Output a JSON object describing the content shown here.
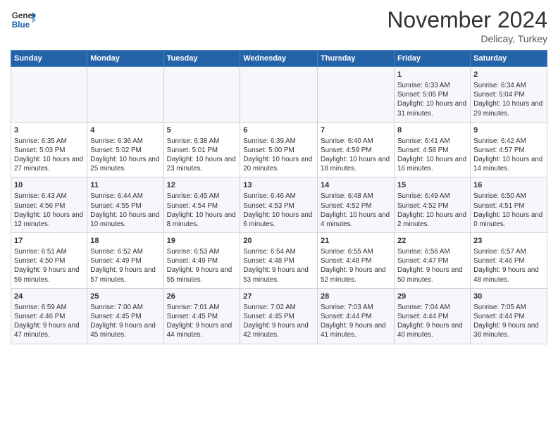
{
  "header": {
    "logo_line1": "General",
    "logo_line2": "Blue",
    "month_title": "November 2024",
    "subtitle": "Delicay, Turkey"
  },
  "weekdays": [
    "Sunday",
    "Monday",
    "Tuesday",
    "Wednesday",
    "Thursday",
    "Friday",
    "Saturday"
  ],
  "weeks": [
    [
      {
        "day": "",
        "info": ""
      },
      {
        "day": "",
        "info": ""
      },
      {
        "day": "",
        "info": ""
      },
      {
        "day": "",
        "info": ""
      },
      {
        "day": "",
        "info": ""
      },
      {
        "day": "1",
        "info": "Sunrise: 6:33 AM\nSunset: 5:05 PM\nDaylight: 10 hours and 31 minutes."
      },
      {
        "day": "2",
        "info": "Sunrise: 6:34 AM\nSunset: 5:04 PM\nDaylight: 10 hours and 29 minutes."
      }
    ],
    [
      {
        "day": "3",
        "info": "Sunrise: 6:35 AM\nSunset: 5:03 PM\nDaylight: 10 hours and 27 minutes."
      },
      {
        "day": "4",
        "info": "Sunrise: 6:36 AM\nSunset: 5:02 PM\nDaylight: 10 hours and 25 minutes."
      },
      {
        "day": "5",
        "info": "Sunrise: 6:38 AM\nSunset: 5:01 PM\nDaylight: 10 hours and 23 minutes."
      },
      {
        "day": "6",
        "info": "Sunrise: 6:39 AM\nSunset: 5:00 PM\nDaylight: 10 hours and 20 minutes."
      },
      {
        "day": "7",
        "info": "Sunrise: 6:40 AM\nSunset: 4:59 PM\nDaylight: 10 hours and 18 minutes."
      },
      {
        "day": "8",
        "info": "Sunrise: 6:41 AM\nSunset: 4:58 PM\nDaylight: 10 hours and 16 minutes."
      },
      {
        "day": "9",
        "info": "Sunrise: 6:42 AM\nSunset: 4:57 PM\nDaylight: 10 hours and 14 minutes."
      }
    ],
    [
      {
        "day": "10",
        "info": "Sunrise: 6:43 AM\nSunset: 4:56 PM\nDaylight: 10 hours and 12 minutes."
      },
      {
        "day": "11",
        "info": "Sunrise: 6:44 AM\nSunset: 4:55 PM\nDaylight: 10 hours and 10 minutes."
      },
      {
        "day": "12",
        "info": "Sunrise: 6:45 AM\nSunset: 4:54 PM\nDaylight: 10 hours and 8 minutes."
      },
      {
        "day": "13",
        "info": "Sunrise: 6:46 AM\nSunset: 4:53 PM\nDaylight: 10 hours and 6 minutes."
      },
      {
        "day": "14",
        "info": "Sunrise: 6:48 AM\nSunset: 4:52 PM\nDaylight: 10 hours and 4 minutes."
      },
      {
        "day": "15",
        "info": "Sunrise: 6:49 AM\nSunset: 4:52 PM\nDaylight: 10 hours and 2 minutes."
      },
      {
        "day": "16",
        "info": "Sunrise: 6:50 AM\nSunset: 4:51 PM\nDaylight: 10 hours and 0 minutes."
      }
    ],
    [
      {
        "day": "17",
        "info": "Sunrise: 6:51 AM\nSunset: 4:50 PM\nDaylight: 9 hours and 59 minutes."
      },
      {
        "day": "18",
        "info": "Sunrise: 6:52 AM\nSunset: 4:49 PM\nDaylight: 9 hours and 57 minutes."
      },
      {
        "day": "19",
        "info": "Sunrise: 6:53 AM\nSunset: 4:49 PM\nDaylight: 9 hours and 55 minutes."
      },
      {
        "day": "20",
        "info": "Sunrise: 6:54 AM\nSunset: 4:48 PM\nDaylight: 9 hours and 53 minutes."
      },
      {
        "day": "21",
        "info": "Sunrise: 6:55 AM\nSunset: 4:48 PM\nDaylight: 9 hours and 52 minutes."
      },
      {
        "day": "22",
        "info": "Sunrise: 6:56 AM\nSunset: 4:47 PM\nDaylight: 9 hours and 50 minutes."
      },
      {
        "day": "23",
        "info": "Sunrise: 6:57 AM\nSunset: 4:46 PM\nDaylight: 9 hours and 48 minutes."
      }
    ],
    [
      {
        "day": "24",
        "info": "Sunrise: 6:59 AM\nSunset: 4:46 PM\nDaylight: 9 hours and 47 minutes."
      },
      {
        "day": "25",
        "info": "Sunrise: 7:00 AM\nSunset: 4:45 PM\nDaylight: 9 hours and 45 minutes."
      },
      {
        "day": "26",
        "info": "Sunrise: 7:01 AM\nSunset: 4:45 PM\nDaylight: 9 hours and 44 minutes."
      },
      {
        "day": "27",
        "info": "Sunrise: 7:02 AM\nSunset: 4:45 PM\nDaylight: 9 hours and 42 minutes."
      },
      {
        "day": "28",
        "info": "Sunrise: 7:03 AM\nSunset: 4:44 PM\nDaylight: 9 hours and 41 minutes."
      },
      {
        "day": "29",
        "info": "Sunrise: 7:04 AM\nSunset: 4:44 PM\nDaylight: 9 hours and 40 minutes."
      },
      {
        "day": "30",
        "info": "Sunrise: 7:05 AM\nSunset: 4:44 PM\nDaylight: 9 hours and 38 minutes."
      }
    ]
  ]
}
